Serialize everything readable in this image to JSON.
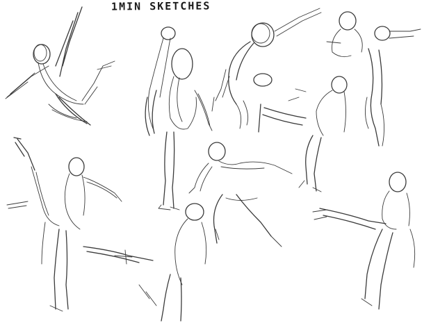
{
  "sheet": {
    "title": "1MIN SKETCHES",
    "ink_color": "#3a3a3a",
    "background": "#ffffff"
  }
}
